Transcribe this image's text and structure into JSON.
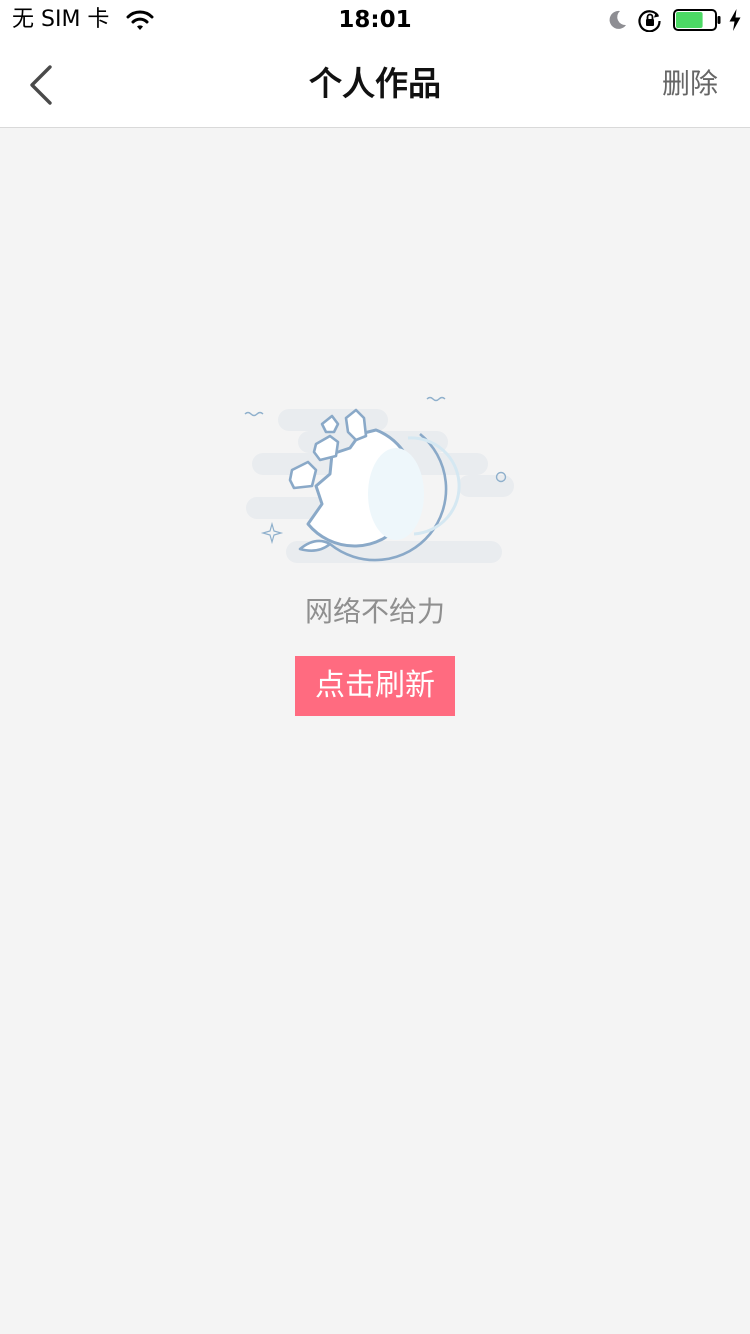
{
  "status_bar": {
    "carrier": "无 SIM 卡",
    "time": "18:01",
    "battery_level": 0.7,
    "battery_color": "#4cd964"
  },
  "nav": {
    "back_icon": "chevron-left-icon",
    "title": "个人作品",
    "delete_label": "删除"
  },
  "empty_state": {
    "illustration_icon": "broken-globe-icon",
    "message": "网络不给力",
    "refresh_label": "点击刷新",
    "accent_color": "#ff6b80"
  }
}
